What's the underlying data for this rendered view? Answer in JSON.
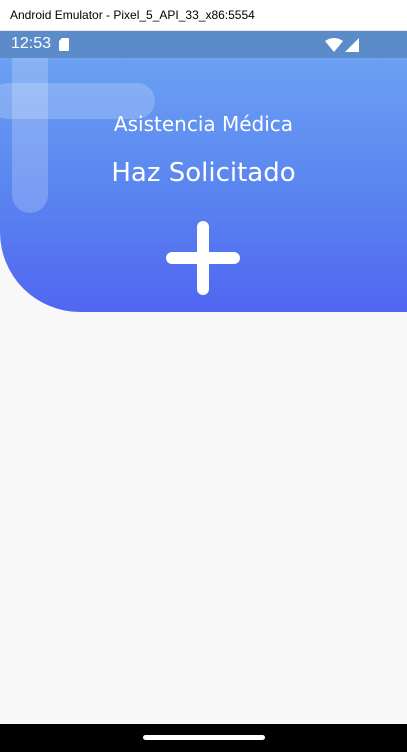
{
  "window": {
    "title": "Android Emulator - Pixel_5_API_33_x86:5554"
  },
  "statusbar": {
    "time": "12:53",
    "icons": [
      "sim-card-icon",
      "wifi-icon",
      "cellular-signal-icon"
    ]
  },
  "header": {
    "subtitle": "Asistencia Médica",
    "title": "Haz Solicitado",
    "icon": "plus-icon",
    "gradient": [
      "#6fa6f3",
      "#5166f1"
    ]
  },
  "colors": {
    "statusbar": "#5b8cc9",
    "background": "#f8f8f8",
    "text": "#ffffff"
  }
}
